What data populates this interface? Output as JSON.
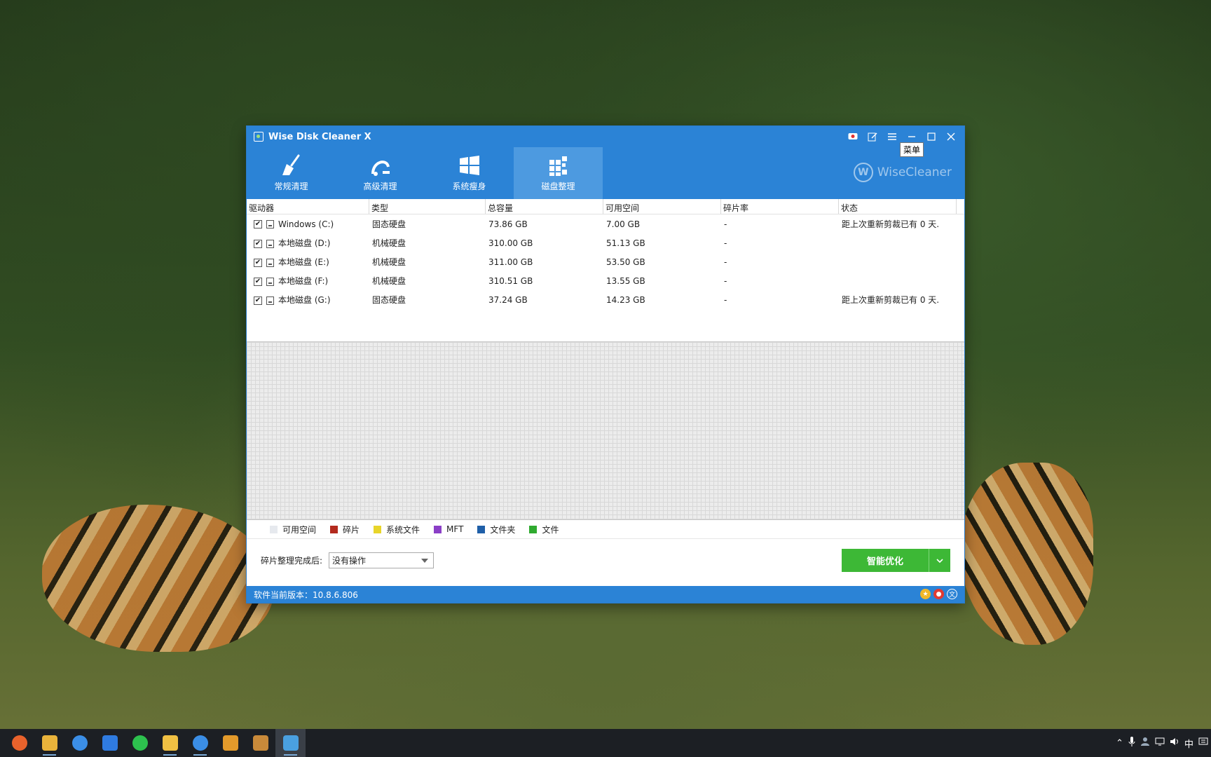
{
  "window": {
    "title": "Wise Disk Cleaner X",
    "tooltip": "菜单",
    "brand": "WiseCleaner",
    "brand_logo": "W"
  },
  "toolbar": {
    "tabs": [
      {
        "label": "常规清理",
        "icon": "broom-icon"
      },
      {
        "label": "高级清理",
        "icon": "advanced-clean-icon"
      },
      {
        "label": "系统瘦身",
        "icon": "windows-icon"
      },
      {
        "label": "磁盘整理",
        "icon": "defrag-icon",
        "active": true
      }
    ]
  },
  "table": {
    "headers": [
      "驱动器",
      "类型",
      "总容量",
      "可用空间",
      "碎片率",
      "状态"
    ],
    "rows": [
      {
        "drive": "Windows (C:)",
        "type": "固态硬盘",
        "total": "73.86 GB",
        "free": "7.00 GB",
        "frag": "-",
        "status": "距上次重新剪裁已有 0 天."
      },
      {
        "drive": "本地磁盘 (D:)",
        "type": "机械硬盘",
        "total": "310.00 GB",
        "free": "51.13 GB",
        "frag": "-",
        "status": ""
      },
      {
        "drive": "本地磁盘 (E:)",
        "type": "机械硬盘",
        "total": "311.00 GB",
        "free": "53.50 GB",
        "frag": "-",
        "status": ""
      },
      {
        "drive": "本地磁盘 (F:)",
        "type": "机械硬盘",
        "total": "310.51 GB",
        "free": "13.55 GB",
        "frag": "-",
        "status": ""
      },
      {
        "drive": "本地磁盘 (G:)",
        "type": "固态硬盘",
        "total": "37.24 GB",
        "free": "14.23 GB",
        "frag": "-",
        "status": "距上次重新剪裁已有 0 天."
      }
    ]
  },
  "legend": [
    {
      "label": "可用空间",
      "color": "#e6e9ee"
    },
    {
      "label": "碎片",
      "color": "#b32a1e"
    },
    {
      "label": "系统文件",
      "color": "#e8d52a"
    },
    {
      "label": "MFT",
      "color": "#8b3fc7"
    },
    {
      "label": "文件夹",
      "color": "#1f5fa8"
    },
    {
      "label": "文件",
      "color": "#2faa2f"
    }
  ],
  "action": {
    "after_label": "碎片整理完成后:",
    "after_value": "没有操作",
    "smart_button": "智能优化"
  },
  "status": {
    "version_text": "软件当前版本：10.8.6.806"
  },
  "taskbar": {
    "apps": [
      {
        "name": "firefox-icon",
        "color": "#e8622c"
      },
      {
        "name": "file-explorer-icon",
        "color": "#e9b33b"
      },
      {
        "name": "chrome-icon",
        "color": "#3b8ee6"
      },
      {
        "name": "feishu-icon",
        "color": "#2f7be0"
      },
      {
        "name": "wechat-icon",
        "color": "#2dc14e"
      },
      {
        "name": "folder-icon",
        "color": "#f0c043"
      },
      {
        "name": "chrome-icon",
        "color": "#3b8ee6"
      },
      {
        "name": "sublime-icon",
        "color": "#e39a2b"
      },
      {
        "name": "package-icon",
        "color": "#c98a3a"
      },
      {
        "name": "wise-disk-cleaner-icon",
        "color": "#4aa0e0"
      }
    ],
    "ime": "中"
  }
}
